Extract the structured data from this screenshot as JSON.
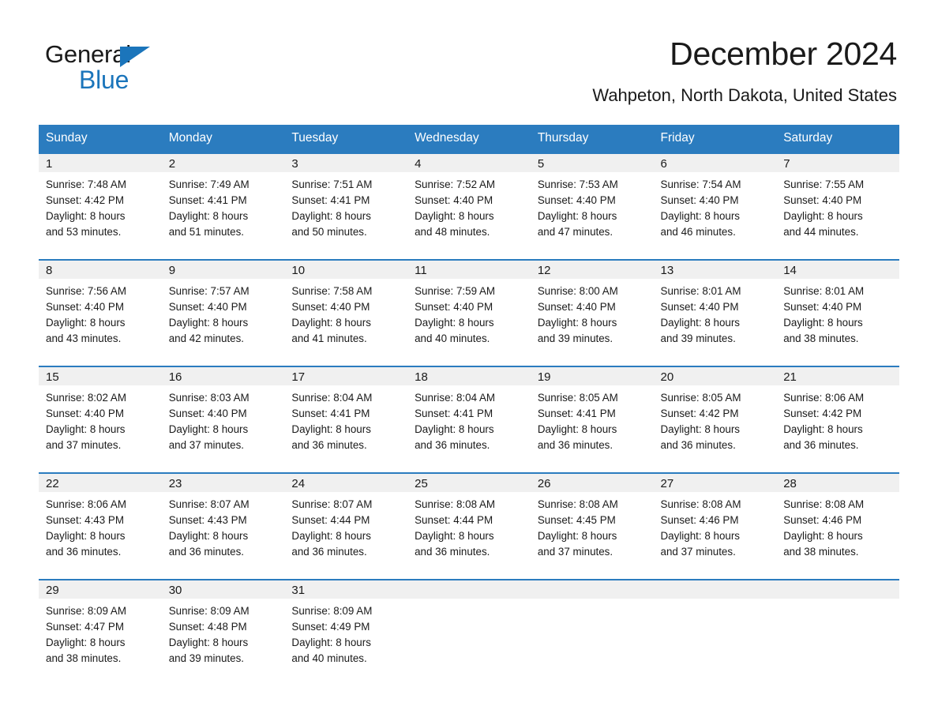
{
  "brand": {
    "name_part1": "General",
    "name_part2": "Blue",
    "accent_color": "#1b75bb"
  },
  "header": {
    "title": "December 2024",
    "location": "Wahpeton, North Dakota, United States"
  },
  "calendar": {
    "header_color": "#2b7cbf",
    "weekday_headers": [
      "Sunday",
      "Monday",
      "Tuesday",
      "Wednesday",
      "Thursday",
      "Friday",
      "Saturday"
    ],
    "weeks": [
      [
        {
          "day": "1",
          "sunrise": "Sunrise: 7:48 AM",
          "sunset": "Sunset: 4:42 PM",
          "daylight_line1": "Daylight: 8 hours",
          "daylight_line2": "and 53 minutes."
        },
        {
          "day": "2",
          "sunrise": "Sunrise: 7:49 AM",
          "sunset": "Sunset: 4:41 PM",
          "daylight_line1": "Daylight: 8 hours",
          "daylight_line2": "and 51 minutes."
        },
        {
          "day": "3",
          "sunrise": "Sunrise: 7:51 AM",
          "sunset": "Sunset: 4:41 PM",
          "daylight_line1": "Daylight: 8 hours",
          "daylight_line2": "and 50 minutes."
        },
        {
          "day": "4",
          "sunrise": "Sunrise: 7:52 AM",
          "sunset": "Sunset: 4:40 PM",
          "daylight_line1": "Daylight: 8 hours",
          "daylight_line2": "and 48 minutes."
        },
        {
          "day": "5",
          "sunrise": "Sunrise: 7:53 AM",
          "sunset": "Sunset: 4:40 PM",
          "daylight_line1": "Daylight: 8 hours",
          "daylight_line2": "and 47 minutes."
        },
        {
          "day": "6",
          "sunrise": "Sunrise: 7:54 AM",
          "sunset": "Sunset: 4:40 PM",
          "daylight_line1": "Daylight: 8 hours",
          "daylight_line2": "and 46 minutes."
        },
        {
          "day": "7",
          "sunrise": "Sunrise: 7:55 AM",
          "sunset": "Sunset: 4:40 PM",
          "daylight_line1": "Daylight: 8 hours",
          "daylight_line2": "and 44 minutes."
        }
      ],
      [
        {
          "day": "8",
          "sunrise": "Sunrise: 7:56 AM",
          "sunset": "Sunset: 4:40 PM",
          "daylight_line1": "Daylight: 8 hours",
          "daylight_line2": "and 43 minutes."
        },
        {
          "day": "9",
          "sunrise": "Sunrise: 7:57 AM",
          "sunset": "Sunset: 4:40 PM",
          "daylight_line1": "Daylight: 8 hours",
          "daylight_line2": "and 42 minutes."
        },
        {
          "day": "10",
          "sunrise": "Sunrise: 7:58 AM",
          "sunset": "Sunset: 4:40 PM",
          "daylight_line1": "Daylight: 8 hours",
          "daylight_line2": "and 41 minutes."
        },
        {
          "day": "11",
          "sunrise": "Sunrise: 7:59 AM",
          "sunset": "Sunset: 4:40 PM",
          "daylight_line1": "Daylight: 8 hours",
          "daylight_line2": "and 40 minutes."
        },
        {
          "day": "12",
          "sunrise": "Sunrise: 8:00 AM",
          "sunset": "Sunset: 4:40 PM",
          "daylight_line1": "Daylight: 8 hours",
          "daylight_line2": "and 39 minutes."
        },
        {
          "day": "13",
          "sunrise": "Sunrise: 8:01 AM",
          "sunset": "Sunset: 4:40 PM",
          "daylight_line1": "Daylight: 8 hours",
          "daylight_line2": "and 39 minutes."
        },
        {
          "day": "14",
          "sunrise": "Sunrise: 8:01 AM",
          "sunset": "Sunset: 4:40 PM",
          "daylight_line1": "Daylight: 8 hours",
          "daylight_line2": "and 38 minutes."
        }
      ],
      [
        {
          "day": "15",
          "sunrise": "Sunrise: 8:02 AM",
          "sunset": "Sunset: 4:40 PM",
          "daylight_line1": "Daylight: 8 hours",
          "daylight_line2": "and 37 minutes."
        },
        {
          "day": "16",
          "sunrise": "Sunrise: 8:03 AM",
          "sunset": "Sunset: 4:40 PM",
          "daylight_line1": "Daylight: 8 hours",
          "daylight_line2": "and 37 minutes."
        },
        {
          "day": "17",
          "sunrise": "Sunrise: 8:04 AM",
          "sunset": "Sunset: 4:41 PM",
          "daylight_line1": "Daylight: 8 hours",
          "daylight_line2": "and 36 minutes."
        },
        {
          "day": "18",
          "sunrise": "Sunrise: 8:04 AM",
          "sunset": "Sunset: 4:41 PM",
          "daylight_line1": "Daylight: 8 hours",
          "daylight_line2": "and 36 minutes."
        },
        {
          "day": "19",
          "sunrise": "Sunrise: 8:05 AM",
          "sunset": "Sunset: 4:41 PM",
          "daylight_line1": "Daylight: 8 hours",
          "daylight_line2": "and 36 minutes."
        },
        {
          "day": "20",
          "sunrise": "Sunrise: 8:05 AM",
          "sunset": "Sunset: 4:42 PM",
          "daylight_line1": "Daylight: 8 hours",
          "daylight_line2": "and 36 minutes."
        },
        {
          "day": "21",
          "sunrise": "Sunrise: 8:06 AM",
          "sunset": "Sunset: 4:42 PM",
          "daylight_line1": "Daylight: 8 hours",
          "daylight_line2": "and 36 minutes."
        }
      ],
      [
        {
          "day": "22",
          "sunrise": "Sunrise: 8:06 AM",
          "sunset": "Sunset: 4:43 PM",
          "daylight_line1": "Daylight: 8 hours",
          "daylight_line2": "and 36 minutes."
        },
        {
          "day": "23",
          "sunrise": "Sunrise: 8:07 AM",
          "sunset": "Sunset: 4:43 PM",
          "daylight_line1": "Daylight: 8 hours",
          "daylight_line2": "and 36 minutes."
        },
        {
          "day": "24",
          "sunrise": "Sunrise: 8:07 AM",
          "sunset": "Sunset: 4:44 PM",
          "daylight_line1": "Daylight: 8 hours",
          "daylight_line2": "and 36 minutes."
        },
        {
          "day": "25",
          "sunrise": "Sunrise: 8:08 AM",
          "sunset": "Sunset: 4:44 PM",
          "daylight_line1": "Daylight: 8 hours",
          "daylight_line2": "and 36 minutes."
        },
        {
          "day": "26",
          "sunrise": "Sunrise: 8:08 AM",
          "sunset": "Sunset: 4:45 PM",
          "daylight_line1": "Daylight: 8 hours",
          "daylight_line2": "and 37 minutes."
        },
        {
          "day": "27",
          "sunrise": "Sunrise: 8:08 AM",
          "sunset": "Sunset: 4:46 PM",
          "daylight_line1": "Daylight: 8 hours",
          "daylight_line2": "and 37 minutes."
        },
        {
          "day": "28",
          "sunrise": "Sunrise: 8:08 AM",
          "sunset": "Sunset: 4:46 PM",
          "daylight_line1": "Daylight: 8 hours",
          "daylight_line2": "and 38 minutes."
        }
      ],
      [
        {
          "day": "29",
          "sunrise": "Sunrise: 8:09 AM",
          "sunset": "Sunset: 4:47 PM",
          "daylight_line1": "Daylight: 8 hours",
          "daylight_line2": "and 38 minutes."
        },
        {
          "day": "30",
          "sunrise": "Sunrise: 8:09 AM",
          "sunset": "Sunset: 4:48 PM",
          "daylight_line1": "Daylight: 8 hours",
          "daylight_line2": "and 39 minutes."
        },
        {
          "day": "31",
          "sunrise": "Sunrise: 8:09 AM",
          "sunset": "Sunset: 4:49 PM",
          "daylight_line1": "Daylight: 8 hours",
          "daylight_line2": "and 40 minutes."
        },
        {
          "day": "",
          "sunrise": "",
          "sunset": "",
          "daylight_line1": "",
          "daylight_line2": ""
        },
        {
          "day": "",
          "sunrise": "",
          "sunset": "",
          "daylight_line1": "",
          "daylight_line2": ""
        },
        {
          "day": "",
          "sunrise": "",
          "sunset": "",
          "daylight_line1": "",
          "daylight_line2": ""
        },
        {
          "day": "",
          "sunrise": "",
          "sunset": "",
          "daylight_line1": "",
          "daylight_line2": ""
        }
      ]
    ]
  }
}
